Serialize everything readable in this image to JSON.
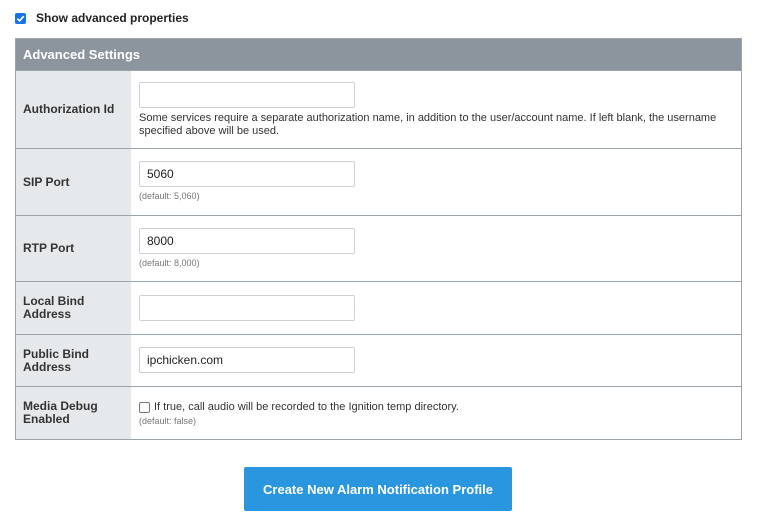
{
  "advanced_toggle": {
    "label": "Show advanced properties",
    "checked": true
  },
  "section": {
    "title": "Advanced Settings",
    "rows": [
      {
        "label": "Authorization Id",
        "value": "",
        "description": "Some services require a separate authorization name, in addition to the user/account name. If left blank, the username specified above will be used."
      },
      {
        "label": "SIP Port",
        "value": "5060",
        "hint": "(default: 5,060)"
      },
      {
        "label": "RTP Port",
        "value": "8000",
        "hint": "(default: 8,000)"
      },
      {
        "label": "Local Bind Address",
        "value": ""
      },
      {
        "label": "Public Bind Address",
        "value": "ipchicken.com"
      },
      {
        "label": "Media Debug Enabled",
        "checkbox_label": "If true, call audio will be recorded to the Ignition temp directory.",
        "checked": false,
        "hint": "(default: false)"
      }
    ]
  },
  "create_button": {
    "label": "Create New Alarm Notification Profile"
  },
  "colors": {
    "header_bg": "#8c959e",
    "label_bg": "#e6e9ec",
    "button_bg": "#2b96e0",
    "checkbox_accent": "#1a73e8"
  }
}
